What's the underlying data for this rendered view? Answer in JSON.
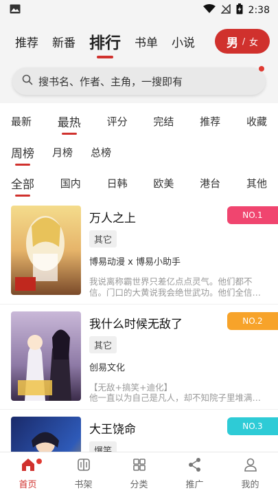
{
  "status_bar": {
    "time": "2:38"
  },
  "top_tabs": [
    {
      "label": "推荐",
      "active": false
    },
    {
      "label": "新番",
      "active": false
    },
    {
      "label": "排行",
      "active": true
    },
    {
      "label": "书单",
      "active": false
    },
    {
      "label": "小说",
      "active": false
    }
  ],
  "gender": {
    "male": "男",
    "separator": "/",
    "female": "女"
  },
  "search": {
    "placeholder": "搜书名、作者、主角，一搜即有"
  },
  "filters": {
    "sort": [
      "最新",
      "最热",
      "评分",
      "完结",
      "推荐",
      "收藏"
    ],
    "period": [
      "周榜",
      "月榜",
      "总榜"
    ],
    "region": [
      "全部",
      "国内",
      "日韩",
      "欧美",
      "港台",
      "其他"
    ]
  },
  "books": [
    {
      "title": "万人之上",
      "tag": "其它",
      "author": "博易动漫 x 博易小助手",
      "desc_line1": "我说离称霸世界只差亿点点灵气。他们都不",
      "desc_line2": "信。门口的大黄说我会绝世武功。他们全信…",
      "rank": "NO.1",
      "rank_color": "#f0456f"
    },
    {
      "title": "我什么时候无敌了",
      "tag": "其它",
      "author": "创易文化",
      "desc_line1": "【无敌+搞笑+迪化】",
      "desc_line2": "他一直以为自己是凡人，却不知院子里堆满…",
      "rank": "NO.2",
      "rank_color": "#f7a32a"
    },
    {
      "title": "大王饶命",
      "tag": "爆笑",
      "author": "",
      "desc_line1": "",
      "desc_line2": "",
      "rank": "NO.3",
      "rank_color": "#2ecbd6"
    }
  ],
  "bottom_nav": [
    {
      "label": "首页",
      "icon": "home-icon",
      "active": true
    },
    {
      "label": "书架",
      "icon": "bookshelf-icon",
      "active": false
    },
    {
      "label": "分类",
      "icon": "category-icon",
      "active": false
    },
    {
      "label": "推广",
      "icon": "share-icon",
      "active": false
    },
    {
      "label": "我的",
      "icon": "profile-icon",
      "active": false
    }
  ],
  "colors": {
    "accent": "#d0312d",
    "background": "#f4f4f4"
  }
}
